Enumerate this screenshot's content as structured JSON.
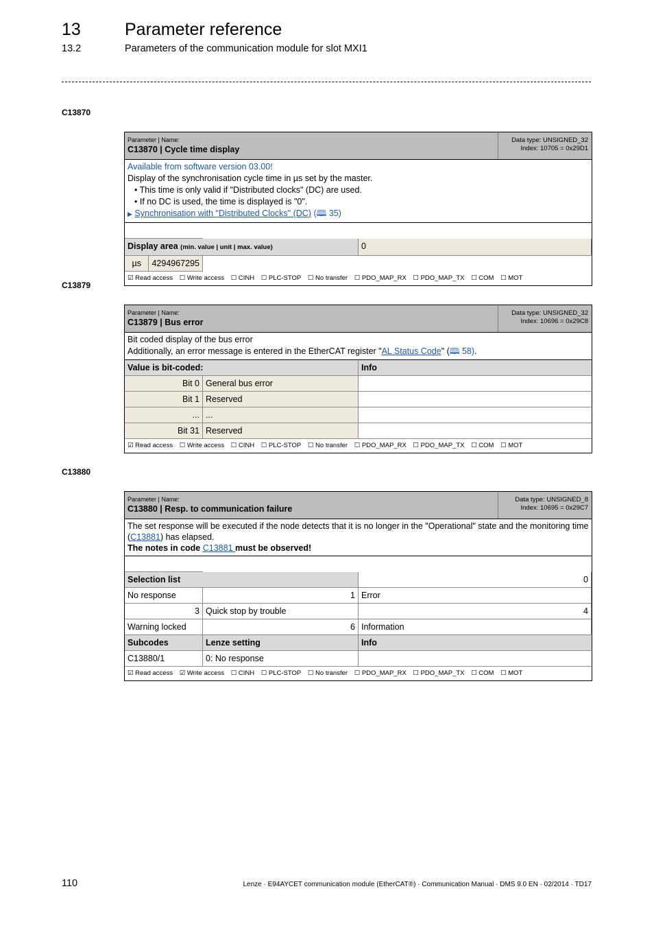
{
  "header": {
    "chapter_number": "13",
    "chapter_title": "Parameter reference",
    "section_number": "13.2",
    "section_title": "Parameters of the communication module for slot MXI1"
  },
  "flag_glyphs": {
    "checked": "☑",
    "unchecked": "☐"
  },
  "params": [
    {
      "heading": "C13870",
      "label_line": "Parameter | Name:",
      "name": "C13870 | Cycle time display",
      "data_type": "Data type: UNSIGNED_32",
      "index": "Index: 10705 = 0x29D1",
      "availability": "Available from software version 03.00!",
      "description": "Display of the synchronisation cycle time in µs set by the master.",
      "bullets": [
        "• This time is only valid if \"Distributed clocks\" (DC) are used.",
        "• If no DC is used, the time is displayed is \"0\"."
      ],
      "see_link": "Synchronisation with \"Distributed Clocks\" (DC)",
      "see_page": "(🕮 35)",
      "display_area": {
        "title": "Display area",
        "subtitle": "(min. value | unit | max. value)",
        "min": "0",
        "unit": "µs",
        "max": "4294967295"
      },
      "flags": [
        "☑ Read access",
        "☐ Write access",
        "☐ CINH",
        "☐ PLC-STOP",
        "☐ No transfer",
        "☐ PDO_MAP_RX",
        "☐ PDO_MAP_TX",
        "☐ COM",
        "☐ MOT"
      ]
    },
    {
      "heading": "C13879",
      "label_line": "Parameter | Name:",
      "name": "C13879 | Bus error",
      "data_type": "Data type: UNSIGNED_32",
      "index": "Index: 10696 = 0x29C8",
      "description_line1": "Bit coded display of the bus error",
      "description_line2_pre": "Additionally, an error message is entered in the EtherCAT register \"",
      "description_link": "AL Status Code",
      "description_line2_post": "\" (",
      "description_page": "🕮 58)",
      "description_end": ".",
      "bit_header": "Value is bit-coded:",
      "info_header": "Info",
      "bits": [
        {
          "bit": "Bit 0",
          "meaning": "General bus error",
          "info": ""
        },
        {
          "bit": "Bit 1",
          "meaning": "Reserved",
          "info": ""
        },
        {
          "bit": "...",
          "meaning": "...",
          "info": ""
        },
        {
          "bit": "Bit 31",
          "meaning": "Reserved",
          "info": ""
        }
      ],
      "flags": [
        "☑ Read access",
        "☐ Write access",
        "☐ CINH",
        "☐ PLC-STOP",
        "☐ No transfer",
        "☐ PDO_MAP_RX",
        "☐ PDO_MAP_TX",
        "☐ COM",
        "☐ MOT"
      ]
    },
    {
      "heading": "C13880",
      "label_line": "Parameter | Name:",
      "name": "C13880 | Resp. to communication failure",
      "data_type": "Data type: UNSIGNED_8",
      "index": "Index: 10695 = 0x29C7",
      "desc_pre": "The set response will be executed if the node detects that it is no longer in the \"Operational\" state and the monitoring time (",
      "desc_link": "C13881",
      "desc_post": ") has elapsed.",
      "note_pre": "The notes in code ",
      "note_link": "C13881 ",
      "note_post": " must be observed!",
      "selection_header": "Selection list",
      "selection": [
        {
          "value": "0",
          "label": "No response"
        },
        {
          "value": "1",
          "label": "Error"
        },
        {
          "value": "3",
          "label": "Quick stop by trouble"
        },
        {
          "value": "4",
          "label": "Warning locked"
        },
        {
          "value": "6",
          "label": "Information"
        }
      ],
      "subcodes_header": "Subcodes",
      "lenze_header": "Lenze setting",
      "info_header": "Info",
      "subcodes": [
        {
          "code": "C13880/1",
          "setting": "0: No response",
          "info": ""
        }
      ],
      "flags": [
        "☑ Read access",
        "☑ Write access",
        "☐ CINH",
        "☐ PLC-STOP",
        "☐ No transfer",
        "☐ PDO_MAP_RX",
        "☐ PDO_MAP_TX",
        "☐ COM",
        "☐ MOT"
      ]
    }
  ],
  "footer": {
    "page_number": "110",
    "text": "Lenze · E94AYCET communication module (EtherCAT®) · Communication Manual · DMS 9.0 EN · 02/2014 · TD17"
  }
}
